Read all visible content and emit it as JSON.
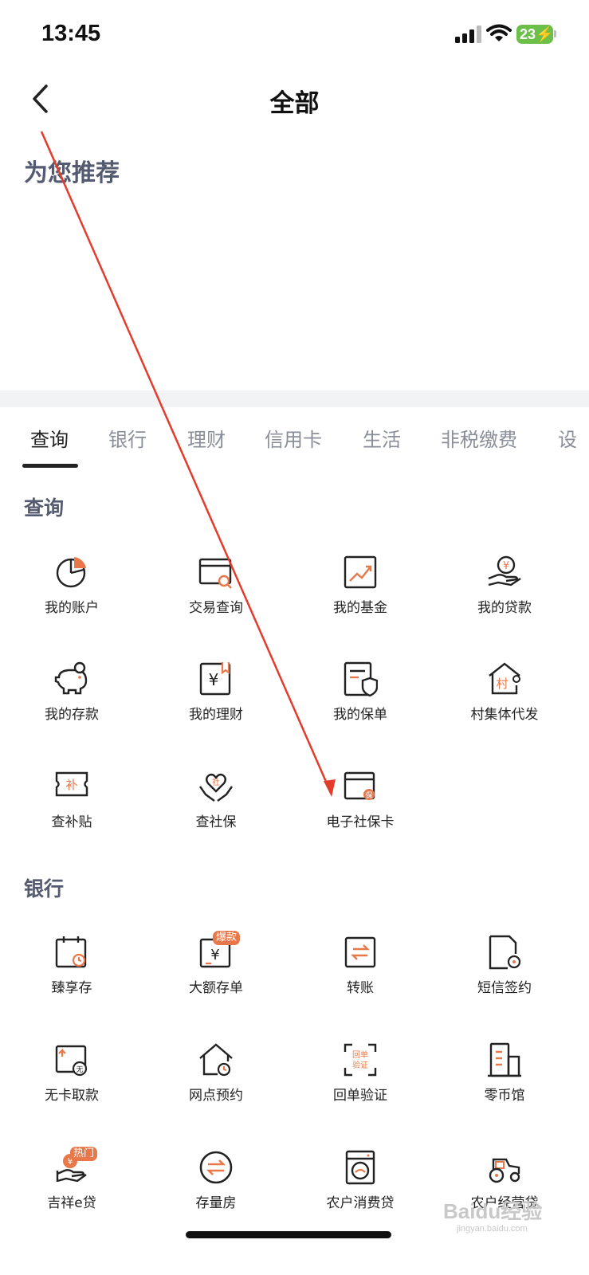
{
  "status_bar": {
    "time": "13:45",
    "battery": "23"
  },
  "nav": {
    "title": "全部",
    "back_icon": "chevron-left-icon"
  },
  "recommend": {
    "title": "为您推荐"
  },
  "tabs": [
    {
      "label": "查询",
      "active": true
    },
    {
      "label": "银行",
      "active": false
    },
    {
      "label": "理财",
      "active": false
    },
    {
      "label": "信用卡",
      "active": false
    },
    {
      "label": "生活",
      "active": false
    },
    {
      "label": "非税缴费",
      "active": false
    },
    {
      "label": "设",
      "active": false
    }
  ],
  "sections": {
    "query": {
      "title": "查询",
      "items": [
        {
          "label": "我的账户",
          "icon": "pie-chart-icon"
        },
        {
          "label": "交易查询",
          "icon": "card-search-icon"
        },
        {
          "label": "我的基金",
          "icon": "trend-chart-icon"
        },
        {
          "label": "我的贷款",
          "icon": "hand-coin-icon"
        },
        {
          "label": "我的存款",
          "icon": "piggy-bank-icon"
        },
        {
          "label": "我的理财",
          "icon": "yuan-bookmark-icon"
        },
        {
          "label": "我的保单",
          "icon": "document-shield-icon"
        },
        {
          "label": "村集体代发",
          "icon": "village-house-icon"
        },
        {
          "label": "查补贴",
          "icon": "subsidy-ticket-icon"
        },
        {
          "label": "查社保",
          "icon": "social-security-hands-icon"
        },
        {
          "label": "电子社保卡",
          "icon": "social-card-icon"
        }
      ]
    },
    "bank": {
      "title": "银行",
      "items": [
        {
          "label": "臻享存",
          "icon": "calendar-clock-icon"
        },
        {
          "label": "大额存单",
          "icon": "yuan-certificate-icon",
          "badge": "爆款"
        },
        {
          "label": "转账",
          "icon": "transfer-icon"
        },
        {
          "label": "短信签约",
          "icon": "sms-document-icon"
        },
        {
          "label": "无卡取款",
          "icon": "cardless-withdraw-icon"
        },
        {
          "label": "网点预约",
          "icon": "branch-house-clock-icon"
        },
        {
          "label": "回单验证",
          "icon": "receipt-verify-icon",
          "icon_text_1": "回单",
          "icon_text_2": "验证"
        },
        {
          "label": "零币馆",
          "icon": "coin-building-icon"
        },
        {
          "label": "吉祥e贷",
          "icon": "loan-hand-icon",
          "badge": "热门"
        },
        {
          "label": "存量房",
          "icon": "exchange-circle-icon"
        },
        {
          "label": "农户消费贷",
          "icon": "washing-machine-icon"
        },
        {
          "label": "农户经营贷",
          "icon": "tractor-icon"
        }
      ]
    }
  },
  "watermark": {
    "text": "Baidu经验",
    "sub": "jingyan.baidu.com"
  },
  "colors": {
    "accent": "#e8784a",
    "annotation": "#e53b2c",
    "section_title": "#545a6f"
  }
}
